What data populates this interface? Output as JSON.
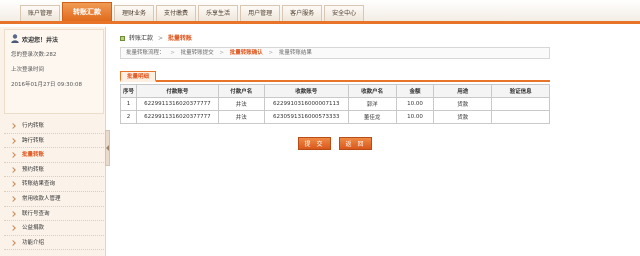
{
  "nav": {
    "items": [
      "账户管理",
      "转账汇款",
      "理财业务",
      "支付缴费",
      "乐享生活",
      "用户管理",
      "客户服务",
      "安全中心"
    ],
    "active_index": 1
  },
  "user": {
    "greeting": "欢迎您！井法",
    "login_count": "您的登录次数:282",
    "last_login_label": "上次登录时间",
    "last_login_time": "2016年01月27日  09:30:08"
  },
  "sidebar": {
    "items": [
      "行内转账",
      "跨行转账",
      "批量转账",
      "预约转账",
      "转账结果查询",
      "常用收款人管理",
      "联行号查询",
      "公益捐款",
      "功能介绍"
    ],
    "active_index": 2
  },
  "breadcrumb": {
    "parent": "转账汇款",
    "separator": ">",
    "current": "批量转账"
  },
  "flow": {
    "label": "批量转账流程：",
    "steps": [
      "批量转账提交",
      "批量转账确认",
      "批量转账结果"
    ],
    "current_index": 1,
    "separator": ">"
  },
  "tab": {
    "label": "批量明细"
  },
  "table": {
    "headers": [
      "序号",
      "付款账号",
      "付款户名",
      "收款账号",
      "收款户名",
      "金额",
      "用途",
      "验证信息"
    ],
    "rows": [
      [
        "1",
        "6229911316020377777",
        "井法",
        "6229910316000007113",
        "郭洋",
        "10.00",
        "货款",
        ""
      ],
      [
        "2",
        "6229911316020377777",
        "井法",
        "6230591316000573333",
        "董佳龙",
        "10.00",
        "货款",
        ""
      ]
    ]
  },
  "buttons": {
    "submit": "提 交",
    "back": "返 回"
  },
  "colors": {
    "accent": "#e8742a",
    "active_text": "#e0531a"
  }
}
